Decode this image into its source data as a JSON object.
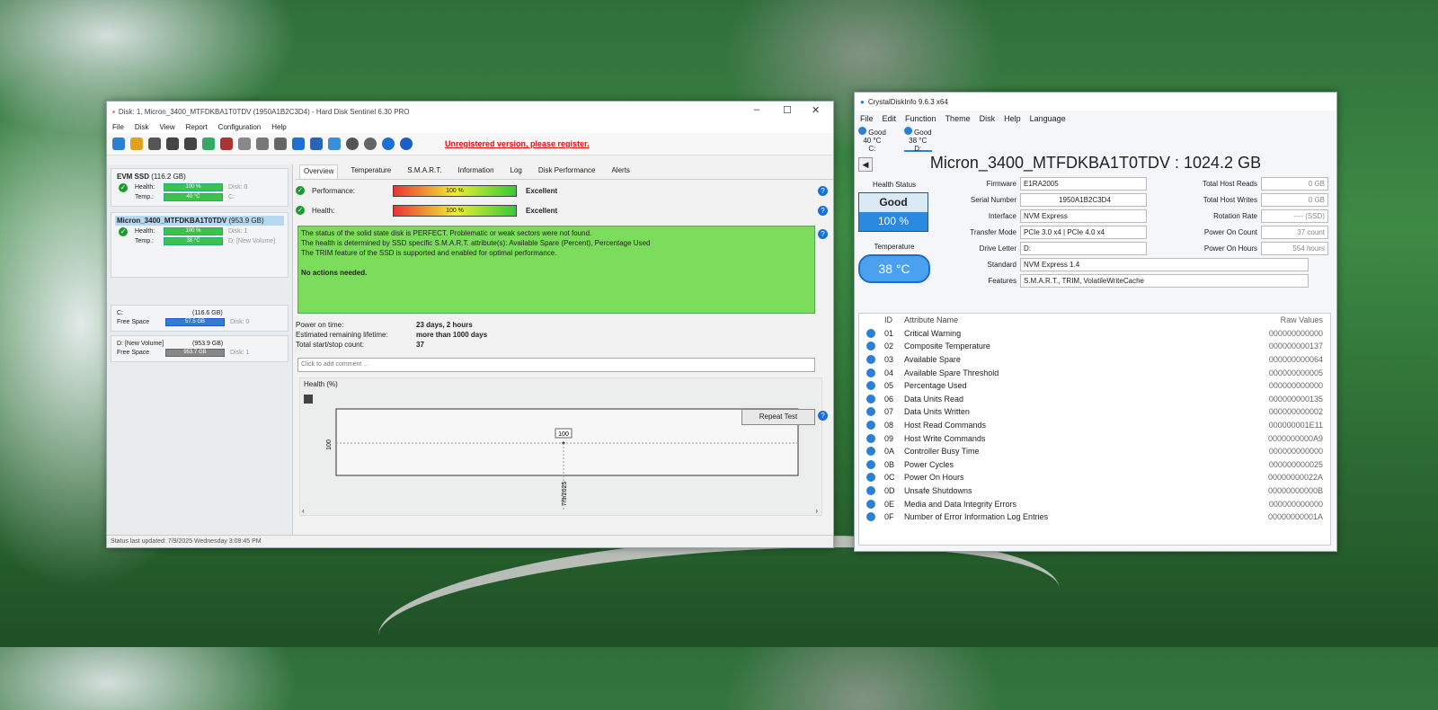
{
  "hds": {
    "title": "Disk: 1, Micron_3400_MTFDKBA1T0TDV (1950A1B2C3D4) - Hard Disk Sentinel 6.30 PRO",
    "menu": [
      "File",
      "Disk",
      "View",
      "Report",
      "Configuration",
      "Help"
    ],
    "unregistered": "Unregistered version, please register.",
    "disks": [
      {
        "name": "EVM SSD",
        "size": "(116.2 GB)",
        "health_label": "Health:",
        "health": "100 %",
        "health_level": 100,
        "health_note": "Disk: 0",
        "temp_label": "Temp.:",
        "temp": "40 °C",
        "temp_note": "C:"
      },
      {
        "name": "Micron_3400_MTFDKBA1T0TDV",
        "size": "(953.9 GB)",
        "health_label": "Health:",
        "health": "100 %",
        "health_level": 100,
        "health_note": "Disk: 1",
        "temp_label": "Temp.:",
        "temp": "38 °C",
        "temp_note": "D: [New Volume]"
      }
    ],
    "volumes": [
      {
        "name": "C:",
        "size": "(116.6 GB)",
        "free_label": "Free Space",
        "free": "57.5 GB",
        "free_level": 49,
        "note": "Disk: 0"
      },
      {
        "name": "D: [New Volume]",
        "size": "(953.9 GB)",
        "free_label": "Free Space",
        "free": "953.7 GB",
        "free_level": 100,
        "note": "Disk: 1"
      }
    ],
    "tabs": [
      "Overview",
      "Temperature",
      "S.M.A.R.T.",
      "Information",
      "Log",
      "Disk Performance",
      "Alerts"
    ],
    "performance": {
      "label": "Performance:",
      "value": "100 %",
      "level": 100,
      "rating": "Excellent"
    },
    "health": {
      "label": "Health:",
      "value": "100 %",
      "level": 100,
      "rating": "Excellent"
    },
    "status_lines": [
      "The status of the solid state disk is PERFECT. Problematic or weak sectors were not found.",
      "The health is determined by SSD specific S.M.A.R.T. attribute(s):  Available Spare (Percent), Percentage Used",
      "The TRIM feature of the SSD is supported and enabled for optimal performance."
    ],
    "no_actions": "No actions needed.",
    "power_on_label": "Power on time:",
    "power_on": "23 days, 2 hours",
    "remaining_label": "Estimated remaining lifetime:",
    "remaining": "more than 1000 days",
    "startstop_label": "Total start/stop count:",
    "startstop": "37",
    "repeat_test": "Repeat Test",
    "comment_placeholder": "Click to add comment ...",
    "chart_title": "Health (%)",
    "statusbar": "Status last updated: 7/9/2025 Wednesday 3:09:45 PM"
  },
  "chart_data": {
    "type": "line",
    "title": "Health (%)",
    "x": [
      "7/9/2025"
    ],
    "series": [
      {
        "values": [
          100
        ]
      }
    ],
    "ylabel": "",
    "ytick": "100",
    "point_label": "100"
  },
  "cdi": {
    "title": "CrystalDiskInfo 9.6.3 x64",
    "menu": [
      "File",
      "Edit",
      "Function",
      "Theme",
      "Disk",
      "Help",
      "Language"
    ],
    "drives": [
      {
        "status": "Good",
        "temp": "40 °C",
        "letter": "C:"
      },
      {
        "status": "Good",
        "temp": "38 °C",
        "letter": "D:"
      }
    ],
    "model": "Micron_3400_MTFDKBA1T0TDV : 1024.2 GB",
    "health_status_label": "Health Status",
    "health_status": "Good",
    "health_percent": "100 %",
    "temperature_label": "Temperature",
    "temperature": "38 °C",
    "fields": [
      {
        "k": "Firmware",
        "v": "E1RA2005"
      },
      {
        "k": "Serial Number",
        "v": "1950A1B2C3D4"
      },
      {
        "k": "Interface",
        "v": "NVM Express"
      },
      {
        "k": "Transfer Mode",
        "v": "PCIe 3.0 x4 | PCIe 4.0 x4"
      },
      {
        "k": "Drive Letter",
        "v": "D:"
      },
      {
        "k": "Standard",
        "v": "NVM Express 1.4"
      },
      {
        "k": "Features",
        "v": "S.M.A.R.T., TRIM, VolatileWriteCache"
      }
    ],
    "right_fields": [
      {
        "k": "Total Host Reads",
        "v": "0 GB"
      },
      {
        "k": "Total Host Writes",
        "v": "0 GB"
      },
      {
        "k": "Rotation Rate",
        "v": "---- (SSD)"
      },
      {
        "k": "Power On Count",
        "v": "37 count"
      },
      {
        "k": "Power On Hours",
        "v": "554 hours"
      }
    ],
    "smart_headers": {
      "id": "ID",
      "name": "Attribute Name",
      "raw": "Raw Values"
    },
    "smart": [
      {
        "id": "01",
        "name": "Critical Warning",
        "raw": "000000000000"
      },
      {
        "id": "02",
        "name": "Composite Temperature",
        "raw": "000000000137"
      },
      {
        "id": "03",
        "name": "Available Spare",
        "raw": "000000000064"
      },
      {
        "id": "04",
        "name": "Available Spare Threshold",
        "raw": "000000000005"
      },
      {
        "id": "05",
        "name": "Percentage Used",
        "raw": "000000000000"
      },
      {
        "id": "06",
        "name": "Data Units Read",
        "raw": "000000000135"
      },
      {
        "id": "07",
        "name": "Data Units Written",
        "raw": "000000000002"
      },
      {
        "id": "08",
        "name": "Host Read Commands",
        "raw": "000000001E11"
      },
      {
        "id": "09",
        "name": "Host Write Commands",
        "raw": "0000000000A9"
      },
      {
        "id": "0A",
        "name": "Controller Busy Time",
        "raw": "000000000000"
      },
      {
        "id": "0B",
        "name": "Power Cycles",
        "raw": "000000000025"
      },
      {
        "id": "0C",
        "name": "Power On Hours",
        "raw": "00000000022A"
      },
      {
        "id": "0D",
        "name": "Unsafe Shutdowns",
        "raw": "00000000000B"
      },
      {
        "id": "0E",
        "name": "Media and Data Integrity Errors",
        "raw": "000000000000"
      },
      {
        "id": "0F",
        "name": "Number of Error Information Log Entries",
        "raw": "00000000001A"
      }
    ]
  }
}
